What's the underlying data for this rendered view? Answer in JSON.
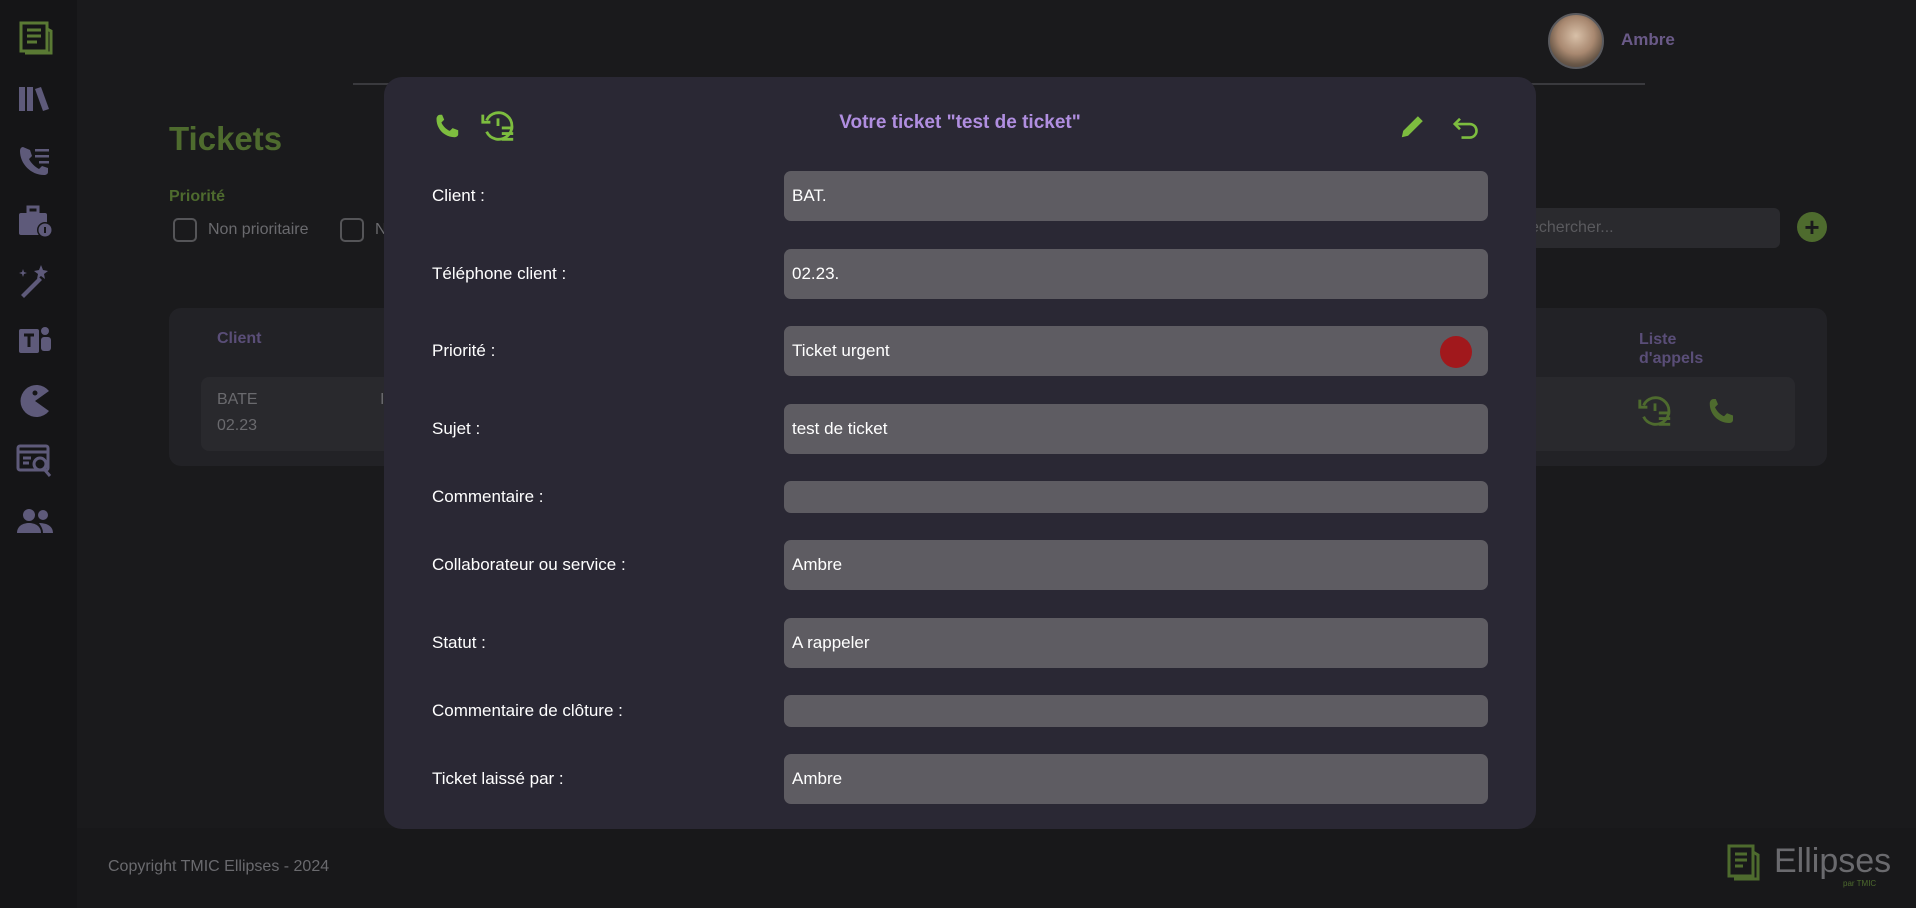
{
  "colors": {
    "accent_green": "#7dbd3f",
    "accent_purple": "#b08ee0",
    "urgent_red": "#a1181c",
    "modal_bg": "#2a2834",
    "field_bg": "#5e5c62"
  },
  "sidebar": {
    "items": [
      {
        "icon": "logo-icon"
      },
      {
        "icon": "library-icon"
      },
      {
        "icon": "call-list-icon"
      },
      {
        "icon": "briefcase-info-icon"
      },
      {
        "icon": "wand-icon"
      },
      {
        "icon": "teams-icon"
      },
      {
        "icon": "pacman-icon"
      },
      {
        "icon": "web-search-icon"
      },
      {
        "icon": "users-icon"
      }
    ]
  },
  "header": {
    "username": "Ambre"
  },
  "page": {
    "title": "Tickets",
    "priority_label": "Priorité",
    "filters": [
      "Non prioritaire",
      "N"
    ],
    "search_placeholder": "echercher...",
    "add_label": "+"
  },
  "table": {
    "col_client": "Client",
    "col_liste_1": "Liste",
    "col_liste_2": "d'appels",
    "row": {
      "client": "BATE",
      "phone": "02.23",
      "partial": "I"
    }
  },
  "footer": {
    "copyright": "Copyright TMIC Ellipses - 2024",
    "brand": "Ellipses",
    "brand_sub": "par TMIC"
  },
  "modal": {
    "title": "Votre ticket \"test de ticket\"",
    "fields": [
      {
        "label": "Client :",
        "value": "BAT."
      },
      {
        "label": "Téléphone client :",
        "value": "02.23."
      },
      {
        "label": "Priorité :",
        "value": "Ticket urgent"
      },
      {
        "label": "Sujet :",
        "value": "test de ticket"
      },
      {
        "label": "Commentaire :",
        "value": ""
      },
      {
        "label": "Collaborateur ou service :",
        "value": "Ambre"
      },
      {
        "label": "Statut :",
        "value": "A rappeler"
      },
      {
        "label": "Commentaire de clôture :",
        "value": ""
      },
      {
        "label": "Ticket laissé par :",
        "value": "Ambre"
      }
    ]
  }
}
